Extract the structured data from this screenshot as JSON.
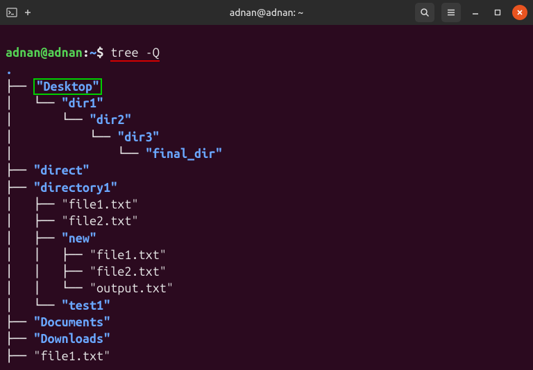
{
  "titlebar": {
    "title": "adnan@adnan: ~"
  },
  "prompt": {
    "user": "adnan@adnan",
    "sep": ":",
    "path": "~",
    "dollar": "$",
    "cmd": "tree -Q"
  },
  "tree": {
    "dot": ".",
    "l0": {
      "prefix": "├── ",
      "name": "\"Desktop\""
    },
    "l1": {
      "prefix": "│   └── ",
      "name": "\"dir1\""
    },
    "l2": {
      "prefix": "│       └── ",
      "name": "\"dir2\""
    },
    "l3": {
      "prefix": "│           └── ",
      "name": "\"dir3\""
    },
    "l4": {
      "prefix": "│               └── ",
      "name": "\"final_dir\""
    },
    "l5": {
      "prefix": "├── ",
      "name": "\"direct\""
    },
    "l6": {
      "prefix": "├── ",
      "name": "\"directory1\""
    },
    "l7": {
      "prefix": "│   ├── ",
      "name": "\"file1.txt\""
    },
    "l8": {
      "prefix": "│   ├── ",
      "name": "\"file2.txt\""
    },
    "l9": {
      "prefix": "│   ├── ",
      "name": "\"new\""
    },
    "l10": {
      "prefix": "│   │   ├── ",
      "name": "\"file1.txt\""
    },
    "l11": {
      "prefix": "│   │   ├── ",
      "name": "\"file2.txt\""
    },
    "l12": {
      "prefix": "│   │   └── ",
      "name": "\"output.txt\""
    },
    "l13": {
      "prefix": "│   └── ",
      "name": "\"test1\""
    },
    "l14": {
      "prefix": "├── ",
      "name": "\"Documents\""
    },
    "l15": {
      "prefix": "├── ",
      "name": "\"Downloads\""
    },
    "l16": {
      "prefix": "├── ",
      "name": "\"file1.txt\""
    }
  }
}
